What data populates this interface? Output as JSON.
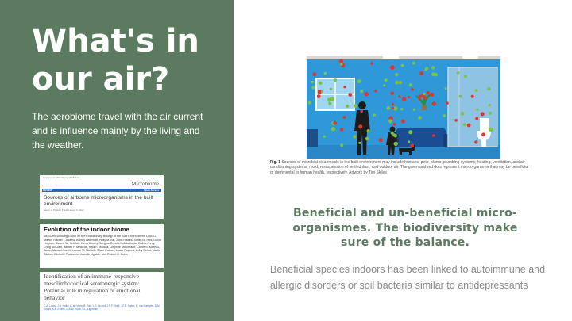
{
  "slide": {
    "title": "What's in our air?",
    "body": "The aerobiome travel with the air current and is influence mainly by the living and the weather.",
    "accent_color": "#5b7a5f"
  },
  "card1": {
    "meta": "Grand et al. Microbiome 2015,3:10",
    "brand": "Microbiome",
    "badge": "REVIEW",
    "access": "Open Access",
    "title": "Sources of airborne microorganisms in the built environment",
    "authors": "Aaron J. Prussin II and Linsey C. Marr"
  },
  "card2": {
    "title": "Evolution of the indoor biome",
    "authors": "NESCent Working Group on the Evolutionary Biology of the Built Environment, Laura J. Martin, Rachel I. Adams, Ashley Bateman, Holly M. Bik, John Hawks, Sarah M. Hird, David Hughes, Steven W. Kembel, Kerry Kinney, Sergios-Orestis Kolokotronis, Gabriel Levy, Craig McClain, James F. Meadow, Raul F. Medina, Gwynne Mhuireach, Corrie S. Moreau, Jason Munshi-South, Lauren M. Nichols, Clare Palmer, Laura Popova, Coby Schal, Martin Täubel, Michelle Trautwein, Juan A. Ugalde, and Robert R. Dunn"
  },
  "card3": {
    "title": "Identification of an immune-responsive mesolimbocortical serotonergic system: Potential role in regulation of emotional behavior",
    "links": "C.A. Lowry, J.H. Hollis, A. de Vries, B. Pan, L.R. Brunet, J.R.F. Hunt, J.F.R. Paton, E. van Kampen, D.M. Knight, A.K. Evans, G.A.W. Rook, S.L. Lightman"
  },
  "figure": {
    "caption_label": "Fig. 1",
    "caption": "Sources of microbial bioaerosols in the built environment may include humans; pets; plants; plumbing systems; heating, ventilation, and air-conditioning systems; mold; resuspension of settled dust; and outdoor air. The green and red dots represent microorganisms that may be beneficial or detrimental to human health, respectively. Artwork by Tim Skiles"
  },
  "main": {
    "heading": "Beneficial and un-beneficial micro-organismes. The biodiversity make sure of the balance.",
    "paragraph": "Beneficial species indoors has been linked to autoimmune and allergic disorders or soil bacteria similar to antidepressants"
  }
}
